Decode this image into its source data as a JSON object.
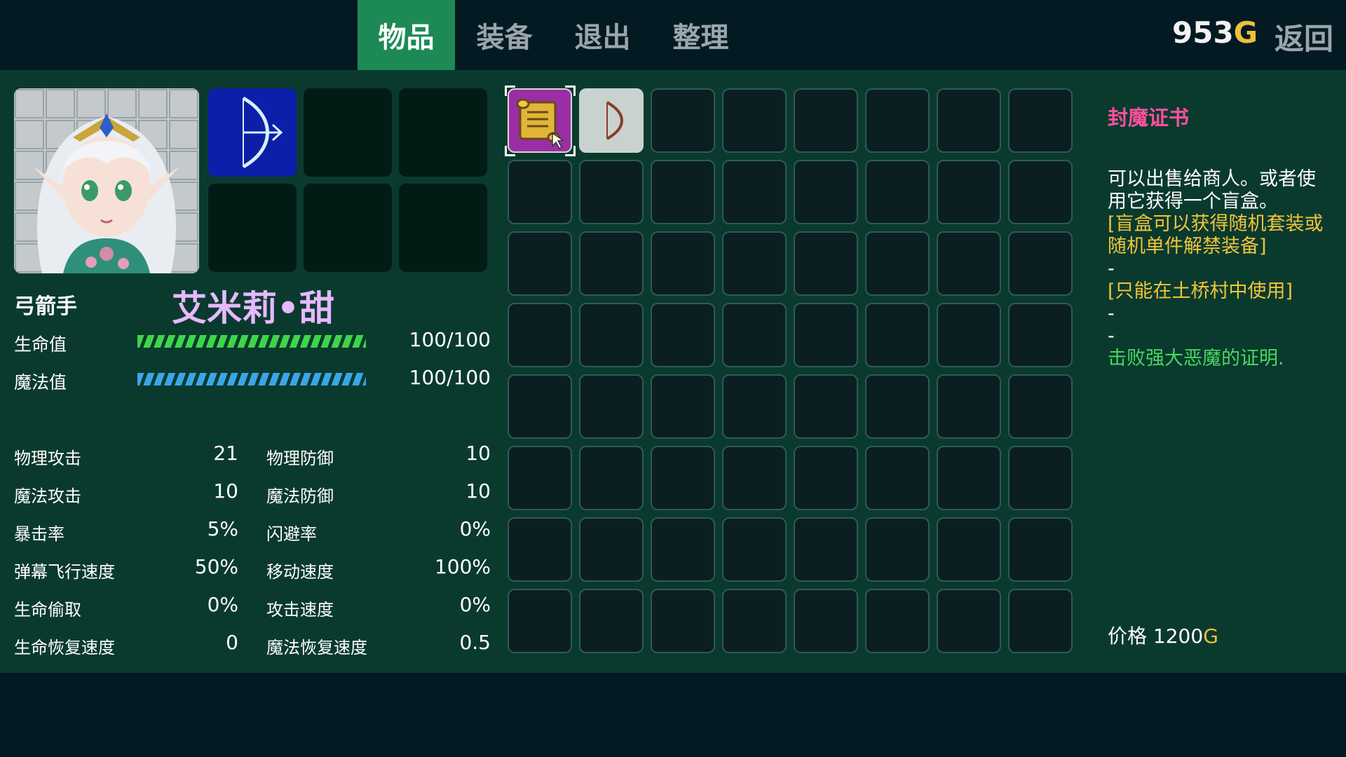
{
  "tabs": [
    "物品",
    "装备",
    "退出",
    "整理"
  ],
  "active_tab": 0,
  "gold": {
    "amount": "953",
    "unit": "G"
  },
  "back_label": "返回",
  "character": {
    "class": "弓箭手",
    "name": "艾米莉•甜",
    "hp": {
      "label": "生命值",
      "value": "100/100",
      "fraction": 1.0
    },
    "mp": {
      "label": "魔法值",
      "value": "100/100",
      "fraction": 1.0
    }
  },
  "stats": {
    "left": [
      {
        "name": "物理攻击",
        "value": "21"
      },
      {
        "name": "魔法攻击",
        "value": "10"
      },
      {
        "name": "暴击率",
        "value": "5%"
      },
      {
        "name": "弹幕飞行速度",
        "value": "50%"
      },
      {
        "name": "生命偷取",
        "value": "0%"
      },
      {
        "name": "生命恢复速度",
        "value": "0"
      }
    ],
    "right": [
      {
        "name": "物理防御",
        "value": "10"
      },
      {
        "name": "魔法防御",
        "value": "10"
      },
      {
        "name": "闪避率",
        "value": "0%"
      },
      {
        "name": "移动速度",
        "value": "100%"
      },
      {
        "name": "攻击速度",
        "value": "0%"
      },
      {
        "name": "魔法恢复速度",
        "value": "0.5"
      }
    ]
  },
  "inventory": {
    "rows": 8,
    "cols": 8,
    "items": [
      {
        "slot": 0,
        "icon": "scroll-icon",
        "selected": true
      },
      {
        "slot": 1,
        "icon": "bow-icon",
        "selected": false
      }
    ]
  },
  "description": {
    "item_name": "封魔证书",
    "lines": [
      {
        "text": "可以出售给商人。或者使",
        "color": "white"
      },
      {
        "text": "用它获得一个盲盒。",
        "color": "white"
      },
      {
        "text": "[盲盒可以获得随机套装或",
        "color": "yellow"
      },
      {
        "text": "随机单件解禁装备]",
        "color": "yellow"
      },
      {
        "text": "-",
        "color": "white"
      },
      {
        "text": "[只能在土桥村中使用]",
        "color": "yellow"
      },
      {
        "text": "-",
        "color": "white"
      },
      {
        "text": "-",
        "color": "white"
      },
      {
        "text": "击败强大恶魔的证明.",
        "color": "green"
      }
    ],
    "price_label": "价格",
    "price_value": "1200",
    "price_unit": "G"
  },
  "colors": {
    "accent": "#1d8a56",
    "hp_bar": "#3ed54a",
    "mp_bar": "#3aa6e8",
    "name": "#e6b9ff",
    "item_name": "#ff4fa0",
    "gold": "#f0bf3a"
  }
}
